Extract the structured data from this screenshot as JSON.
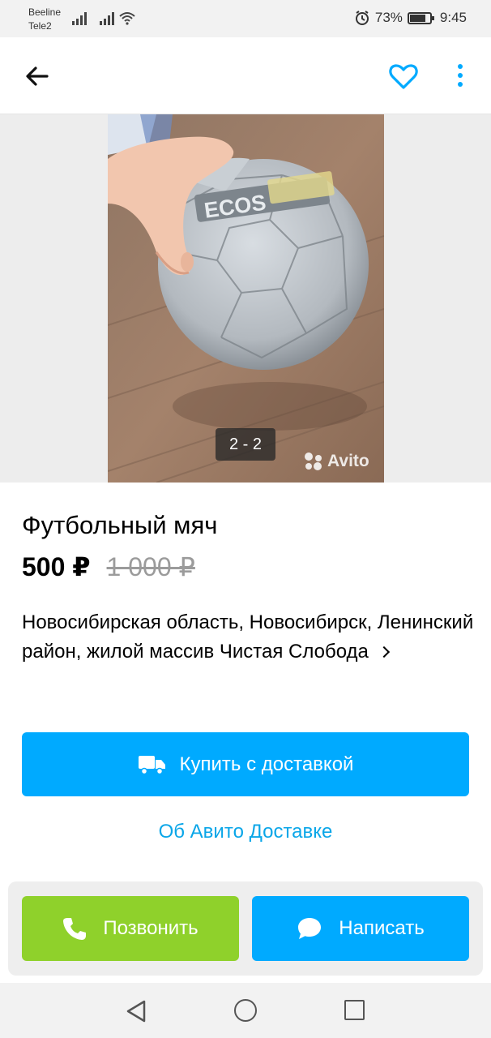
{
  "status_bar": {
    "carrier1": "Beeline",
    "carrier2": "Tele2",
    "battery": "73%",
    "time": "9:45"
  },
  "gallery": {
    "counter": "2 - 2",
    "watermark": "Avito",
    "ball_brand": "ECOS"
  },
  "listing": {
    "title": "Футбольный мяч",
    "price": "500 ₽",
    "old_price": "1 000 ₽",
    "address": "Новосибирская область, Новосибирск, Ленинский район, жилой массив Чистая Слобода"
  },
  "delivery": {
    "buy_label": "Купить с доставкой",
    "about_link": "Об Авито Доставке"
  },
  "actions": {
    "call_label": "Позвонить",
    "write_label": "Написать"
  },
  "colors": {
    "accent_blue": "#00aaff",
    "call_green": "#8fd12b",
    "link_blue": "#0aa6e8"
  },
  "icons": [
    "back-arrow-icon",
    "heart-icon",
    "more-vertical-icon",
    "truck-icon",
    "phone-icon",
    "chat-icon",
    "alarm-icon",
    "wifi-icon",
    "signal-icon",
    "battery-icon"
  ]
}
